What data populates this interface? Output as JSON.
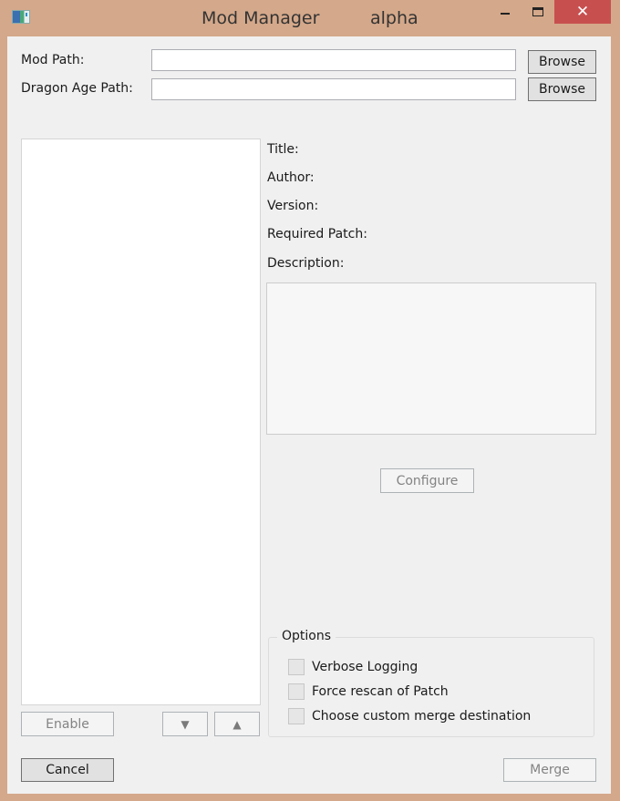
{
  "window": {
    "title": "Mod Manager",
    "title_tag": "alpha",
    "minimize_icon": "minimize-icon",
    "maximize_icon": "maximize-icon",
    "close_icon": "close-icon",
    "close_glyph": "✕"
  },
  "paths": {
    "mod_path_label": "Mod Path:",
    "mod_path_value": "",
    "dragon_age_path_label": "Dragon Age Path:",
    "dragon_age_path_value": "",
    "browse_label": "Browse"
  },
  "mod_list": {
    "items": [],
    "enable_label": "Enable",
    "move_down_glyph": "▼",
    "move_up_glyph": "▲"
  },
  "details": {
    "title_label": "Title:",
    "author_label": "Author:",
    "version_label": "Version:",
    "required_patch_label": "Required Patch:",
    "description_label": "Description:",
    "description_value": "",
    "configure_label": "Configure"
  },
  "options": {
    "legend": "Options",
    "items": [
      {
        "label": "Verbose Logging",
        "checked": false
      },
      {
        "label": "Force rescan of Patch",
        "checked": false
      },
      {
        "label": "Choose custom merge destination",
        "checked": false
      }
    ]
  },
  "footer": {
    "cancel_label": "Cancel",
    "merge_label": "Merge"
  }
}
